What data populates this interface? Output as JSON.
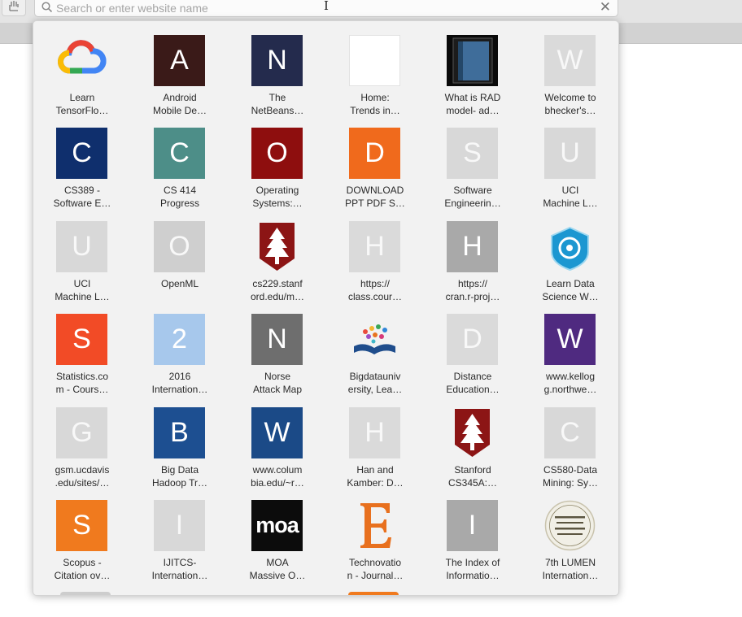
{
  "address_bar": {
    "placeholder": "Search or enter website name",
    "value": ""
  },
  "favorites": [
    {
      "label": "Learn\nTensorFlo…",
      "letter": "",
      "icon": "google-cloud-icon",
      "bg": "",
      "fg": ""
    },
    {
      "label": "Android\nMobile De…",
      "letter": "A",
      "icon": "letter-tile",
      "bg": "#3a1a18",
      "fg": "#ffffff"
    },
    {
      "label": "The\nNetBeans…",
      "letter": "N",
      "icon": "letter-tile",
      "bg": "#242b4d",
      "fg": "#ffffff"
    },
    {
      "label": "Home:\nTrends in…",
      "letter": "",
      "icon": "blank-tile",
      "bg": "#ffffff",
      "fg": "#ffffff"
    },
    {
      "label": "What is RAD\nmodel- ad…",
      "letter": "",
      "icon": "book-thumbnail-icon",
      "bg": "",
      "fg": ""
    },
    {
      "label": "Welcome to\nbhecker's…",
      "letter": "W",
      "icon": "letter-tile",
      "bg": "#dadada",
      "fg": "#f8f8f8"
    },
    {
      "label": "CS389 -\nSoftware E…",
      "letter": "C",
      "icon": "letter-tile",
      "bg": "#0f2f6d",
      "fg": "#ffffff"
    },
    {
      "label": "CS 414\nProgress",
      "letter": "C",
      "icon": "letter-tile",
      "bg": "#4d8e88",
      "fg": "#ffffff"
    },
    {
      "label": "Operating\nSystems:…",
      "letter": "O",
      "icon": "letter-tile",
      "bg": "#8e0e0e",
      "fg": "#ffffff"
    },
    {
      "label": "DOWNLOAD\nPPT PDF S…",
      "letter": "D",
      "icon": "letter-tile",
      "bg": "#f06a1c",
      "fg": "#ffffff"
    },
    {
      "label": "Software\nEngineerin…",
      "letter": "S",
      "icon": "letter-tile",
      "bg": "#d8d8d8",
      "fg": "#f8f8f8"
    },
    {
      "label": "UCI\nMachine L…",
      "letter": "U",
      "icon": "letter-tile",
      "bg": "#d8d8d8",
      "fg": "#f8f8f8"
    },
    {
      "label": "UCI\nMachine L…",
      "letter": "U",
      "icon": "letter-tile",
      "bg": "#d8d8d8",
      "fg": "#f8f8f8"
    },
    {
      "label": "OpenML",
      "letter": "O",
      "icon": "letter-tile",
      "bg": "#cfcfcf",
      "fg": "#f8f8f8"
    },
    {
      "label": "cs229.stanf\nord.edu/m…",
      "letter": "",
      "icon": "stanford-tree-icon",
      "bg": "",
      "fg": ""
    },
    {
      "label": "https://\nclass.cour…",
      "letter": "H",
      "icon": "letter-tile",
      "bg": "#dadada",
      "fg": "#f8f8f8"
    },
    {
      "label": "https://\ncran.r-proj…",
      "letter": "H",
      "icon": "letter-tile",
      "bg": "#a9a9a9",
      "fg": "#ffffff"
    },
    {
      "label": "Learn Data\nScience W…",
      "letter": "",
      "icon": "data-science-shield-icon",
      "bg": "",
      "fg": ""
    },
    {
      "label": "Statistics.co\nm - Cours…",
      "letter": "S",
      "icon": "letter-tile",
      "bg": "#f24b26",
      "fg": "#ffffff"
    },
    {
      "label": "2016\nInternation…",
      "letter": "2",
      "icon": "letter-tile",
      "bg": "#a7c8ec",
      "fg": "#ffffff"
    },
    {
      "label": "Norse\nAttack Map",
      "letter": "N",
      "icon": "letter-tile",
      "bg": "#6e6e6e",
      "fg": "#ffffff"
    },
    {
      "label": "Bigdatauniv\nersity, Lea…",
      "letter": "",
      "icon": "open-book-icon",
      "bg": "",
      "fg": ""
    },
    {
      "label": "Distance\nEducation…",
      "letter": "D",
      "icon": "letter-tile",
      "bg": "#dadada",
      "fg": "#f8f8f8"
    },
    {
      "label": "www.kellog\ng.northwe…",
      "letter": "W",
      "icon": "letter-tile",
      "bg": "#4f2a80",
      "fg": "#ffffff"
    },
    {
      "label": "gsm.ucdavis\n.edu/sites/…",
      "letter": "G",
      "icon": "letter-tile",
      "bg": "#d8d8d8",
      "fg": "#f8f8f8"
    },
    {
      "label": "Big Data\nHadoop Tr…",
      "letter": "B",
      "icon": "letter-tile",
      "bg": "#1d4f91",
      "fg": "#ffffff"
    },
    {
      "label": "www.colum\nbia.edu/~r…",
      "letter": "W",
      "icon": "letter-tile",
      "bg": "#1b4a87",
      "fg": "#ffffff"
    },
    {
      "label": "Han and\nKamber: D…",
      "letter": "H",
      "icon": "letter-tile",
      "bg": "#dadada",
      "fg": "#f8f8f8"
    },
    {
      "label": "Stanford\nCS345A:…",
      "letter": "",
      "icon": "stanford-tree-icon",
      "bg": "",
      "fg": ""
    },
    {
      "label": "CS580-Data\nMining: Sy…",
      "letter": "C",
      "icon": "letter-tile",
      "bg": "#d8d8d8",
      "fg": "#f8f8f8"
    },
    {
      "label": "Scopus -\nCitation ov…",
      "letter": "S",
      "icon": "letter-tile",
      "bg": "#f07a1e",
      "fg": "#ffffff"
    },
    {
      "label": "IJITCS-\nInternation…",
      "letter": "I",
      "icon": "letter-tile",
      "bg": "#d8d8d8",
      "fg": "#f8f8f8"
    },
    {
      "label": "MOA\nMassive O…",
      "letter": "moa",
      "icon": "moa-logo-icon",
      "bg": "#0c0c0c",
      "fg": "#ffffff"
    },
    {
      "label": "Technovatio\nn - Journal…",
      "letter": "E",
      "icon": "serif-e-logo-icon",
      "bg": "",
      "fg": "#e8701e"
    },
    {
      "label": "The Index of\nInformatio…",
      "letter": "I",
      "icon": "letter-tile",
      "bg": "#a9a9a9",
      "fg": "#ffffff"
    },
    {
      "label": "7th LUMEN\nInternation…",
      "letter": "",
      "icon": "rethinking-social-action-seal-icon",
      "bg": "",
      "fg": ""
    }
  ],
  "colors": {
    "popover_bg": "#f2f2f2",
    "toolbar_bg": "#e4e4e4",
    "peek_orange": "#f07a1e"
  }
}
